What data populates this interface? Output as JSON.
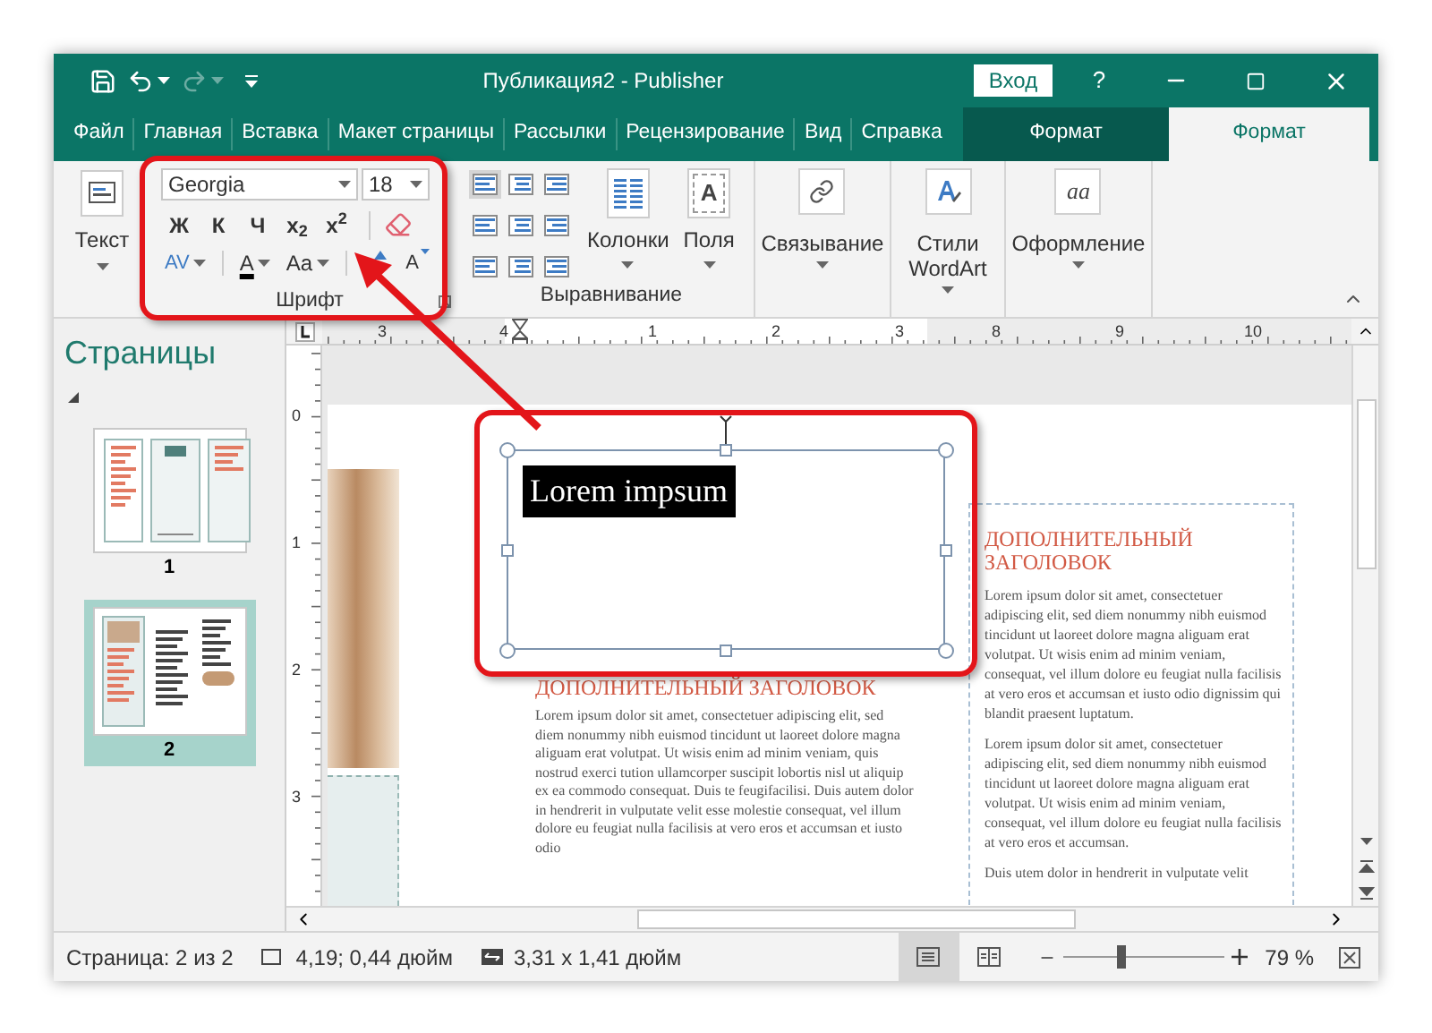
{
  "window": {
    "title": "Публикация2 - Publisher",
    "sign_in": "Вход",
    "help": "?",
    "redo_disabled": true
  },
  "tabs": [
    {
      "label": "Файл",
      "kind": "main",
      "selected": false
    },
    {
      "label": "Главная",
      "kind": "main",
      "selected": false
    },
    {
      "label": "Вставка",
      "kind": "main",
      "selected": false
    },
    {
      "label": "Макет страницы",
      "kind": "main",
      "selected": false
    },
    {
      "label": "Рассылки",
      "kind": "main",
      "selected": false
    },
    {
      "label": "Рецензирование",
      "kind": "main",
      "selected": false
    },
    {
      "label": "Вид",
      "kind": "main",
      "selected": false
    },
    {
      "label": "Справка",
      "kind": "main",
      "selected": false
    },
    {
      "label": "Формат",
      "kind": "contextual",
      "selected": false
    },
    {
      "label": "Формат",
      "kind": "contextual",
      "selected": true
    }
  ],
  "ribbon": {
    "text_button": "Текст",
    "font_group": {
      "label": "Шрифт",
      "font": "Georgia",
      "size": "18",
      "styles": [
        "Ж",
        "К",
        "Ч",
        "x$_{2}$",
        "x$^{2}$"
      ],
      "spacing": "AV",
      "font_color": "A",
      "change_case": "Aa",
      "shrink_font": "A"
    },
    "align_group": {
      "label": "Выравнивание",
      "alignments": [
        {
          "kind": "left",
          "selected": true
        },
        {
          "kind": "center",
          "selected": false
        },
        {
          "kind": "right",
          "selected": false
        },
        {
          "kind": "left",
          "selected": false
        },
        {
          "kind": "center",
          "selected": false
        },
        {
          "kind": "right",
          "selected": false
        },
        {
          "kind": "left",
          "selected": false
        },
        {
          "kind": "center",
          "selected": false
        },
        {
          "kind": "right",
          "selected": false
        }
      ],
      "columns": "Колонки",
      "margins": "Поля",
      "margins_icon": "A"
    },
    "commands": [
      {
        "kind": "link",
        "label": "Связывание"
      },
      {
        "kind": "wordart",
        "label": "Стили WordArt"
      },
      {
        "kind": "design",
        "label": "Оформление",
        "icon_text": "aa"
      }
    ]
  },
  "pages_panel": {
    "title": "Страницы",
    "pages": [
      {
        "number": "1",
        "kind": "cover",
        "selected": false
      },
      {
        "number": "2",
        "kind": "inside",
        "selected": true
      }
    ]
  },
  "rulers": {
    "horizontal": [
      "3",
      "4",
      "1",
      "2",
      "3",
      "8",
      "9",
      "10"
    ],
    "vertical": [
      "0",
      "1",
      "2",
      "3"
    ]
  },
  "document": {
    "text_box": "Lorem impsum",
    "middle_column": {
      "heading": "ДОПОЛНИТЕЛЬНЫЙ ЗАГОЛОВОК",
      "paragraphs": [
        "Lorem ipsum dolor sit amet, consectetuer adipiscing elit, sed diem nonummy nibh euismod tincidunt ut laoreet dolore magna aliguam erat volutpat. Ut wisis enim ad minim veniam, quis nostrud exerci tution ullamcorper suscipit lobortis nisl ut aliquip ex ea commodo consequat. Duis te feugifacilisi. Duis autem dolor in hendrerit in vulputate velit esse molestie consequat, vel illum dolore eu feugiat nulla facilisis at vero eros et accumsan et iusto odio"
      ]
    },
    "right_column": {
      "heading": "ДОПОЛНИТЕЛЬНЫЙ ЗАГОЛОВОК",
      "paragraphs": [
        "Lorem ipsum dolor sit amet, consectetuer adipiscing elit, sed diem nonummy nibh euismod tincidunt ut laoreet dolore magna aliguam erat volutpat. Ut wisis enim ad minim veniam, consequat, vel illum dolore eu feugiat nulla facilisis at vero eros et accumsan et iusto odio dignissim qui blandit praesent luptatum.",
        "Lorem ipsum dolor sit amet, consectetuer adipiscing elit, sed diem nonummy nibh euismod tincidunt ut laoreet dolore magna aliguam erat volutpat. Ut wisis enim ad minim veniam, consequat, vel illum dolore eu feugiat nulla facilisis at vero eros et accumsan.",
        "Duis utem dolor in hendrerit in vulputate velit"
      ]
    }
  },
  "status_bar": {
    "page": "Страница: 2 из 2",
    "position": "4,19; 0,44 дюйм",
    "size": "3,31 x 1,41 дюйм",
    "views": [
      {
        "kind": "single",
        "selected": true
      },
      {
        "kind": "spread",
        "selected": false
      }
    ],
    "zoom": {
      "level": 0.36,
      "reading": "79 %"
    }
  }
}
